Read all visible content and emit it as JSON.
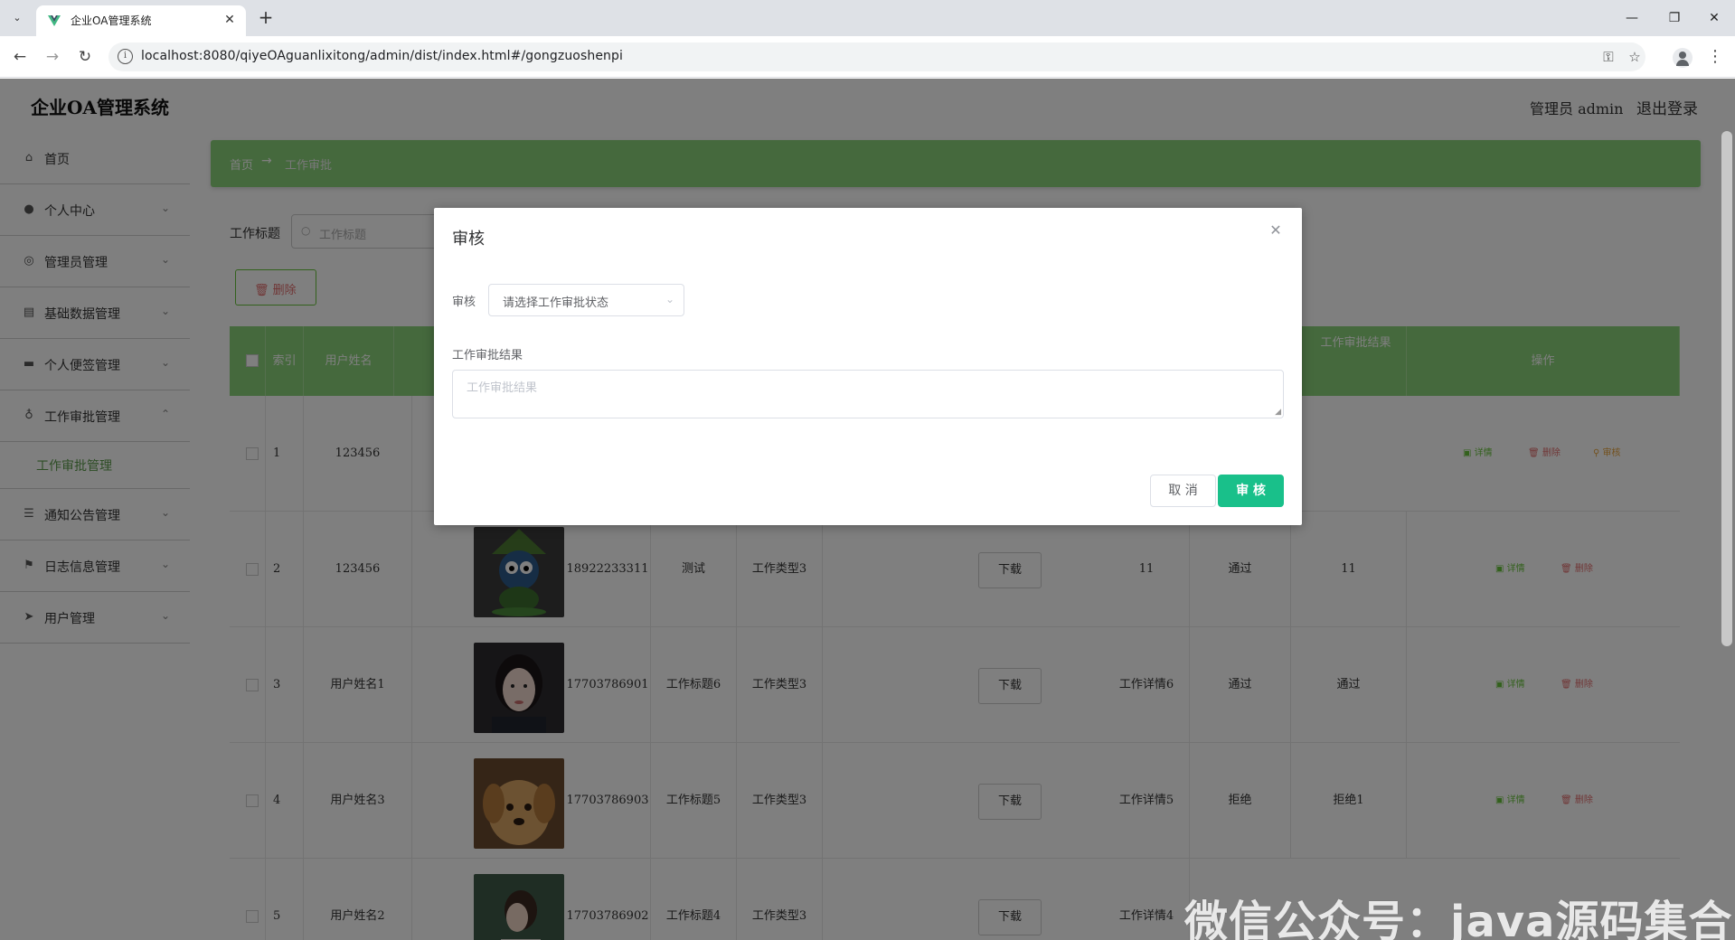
{
  "browser": {
    "tab_title": "企业OA管理系统",
    "url": "localhost:8080/qiyeOAguanlixitong/admin/dist/index.html#/gongzuoshenpi"
  },
  "header": {
    "app_title": "企业OA管理系统",
    "user": "管理员 admin",
    "logout": "退出登录"
  },
  "sidebar": {
    "items": [
      {
        "label": "首页",
        "icon": "home-icon"
      },
      {
        "label": "个人中心",
        "icon": "user-icon"
      },
      {
        "label": "管理员管理",
        "icon": "compass-icon"
      },
      {
        "label": "基础数据管理",
        "icon": "clipboard-icon"
      },
      {
        "label": "个人便签管理",
        "icon": "monitor-icon"
      },
      {
        "label": "工作审批管理",
        "icon": "microphone-icon"
      },
      {
        "label": "通知公告管理",
        "icon": "list-icon"
      },
      {
        "label": "日志信息管理",
        "icon": "flag-icon"
      },
      {
        "label": "用户管理",
        "icon": "send-icon"
      }
    ],
    "sub_active": "工作审批管理"
  },
  "breadcrumb": {
    "home": "首页",
    "arrow": "→",
    "current": "工作审批"
  },
  "search": {
    "label": "工作标题",
    "placeholder": "工作标题"
  },
  "toolbar": {
    "delete_label": "删除"
  },
  "table": {
    "headers": {
      "index": "索引",
      "username": "用户姓名",
      "result": "工作审批结果",
      "ops": "操作"
    },
    "rows": [
      {
        "idx": "1",
        "name": "123456",
        "phone": "",
        "title": "",
        "type": "",
        "download": "",
        "detail": "",
        "status": "",
        "result": "",
        "audit": true
      },
      {
        "idx": "2",
        "name": "123456",
        "phone": "18922233311",
        "title": "测试",
        "type": "工作类型3",
        "download": "下载",
        "detail": "11",
        "status": "通过",
        "result": "11",
        "audit": false
      },
      {
        "idx": "3",
        "name": "用户姓名1",
        "phone": "17703786901",
        "title": "工作标题6",
        "type": "工作类型3",
        "download": "下载",
        "detail": "工作详情6",
        "status": "通过",
        "result": "通过",
        "audit": false
      },
      {
        "idx": "4",
        "name": "用户姓名3",
        "phone": "17703786903",
        "title": "工作标题5",
        "type": "工作类型3",
        "download": "下载",
        "detail": "工作详情5",
        "status": "拒绝",
        "result": "拒绝1",
        "audit": false
      },
      {
        "idx": "5",
        "name": "用户姓名2",
        "phone": "17703786902",
        "title": "工作标题4",
        "type": "工作类型3",
        "download": "下载",
        "detail": "工作详情4",
        "status": "",
        "result": "",
        "audit": false
      }
    ],
    "actions": {
      "detail": "详情",
      "delete": "删除",
      "audit": "审核"
    }
  },
  "dialog": {
    "title": "审核",
    "field_audit_label": "审核",
    "select_placeholder": "请选择工作审批状态",
    "result_label": "工作审批结果",
    "result_placeholder": "工作审批结果",
    "cancel": "取 消",
    "confirm": "审 核"
  },
  "watermark": "微信公众号：java源码集合",
  "colors": {
    "accent": "#8bd27a",
    "confirm": "#19c08a",
    "delete": "#e06c6c"
  }
}
